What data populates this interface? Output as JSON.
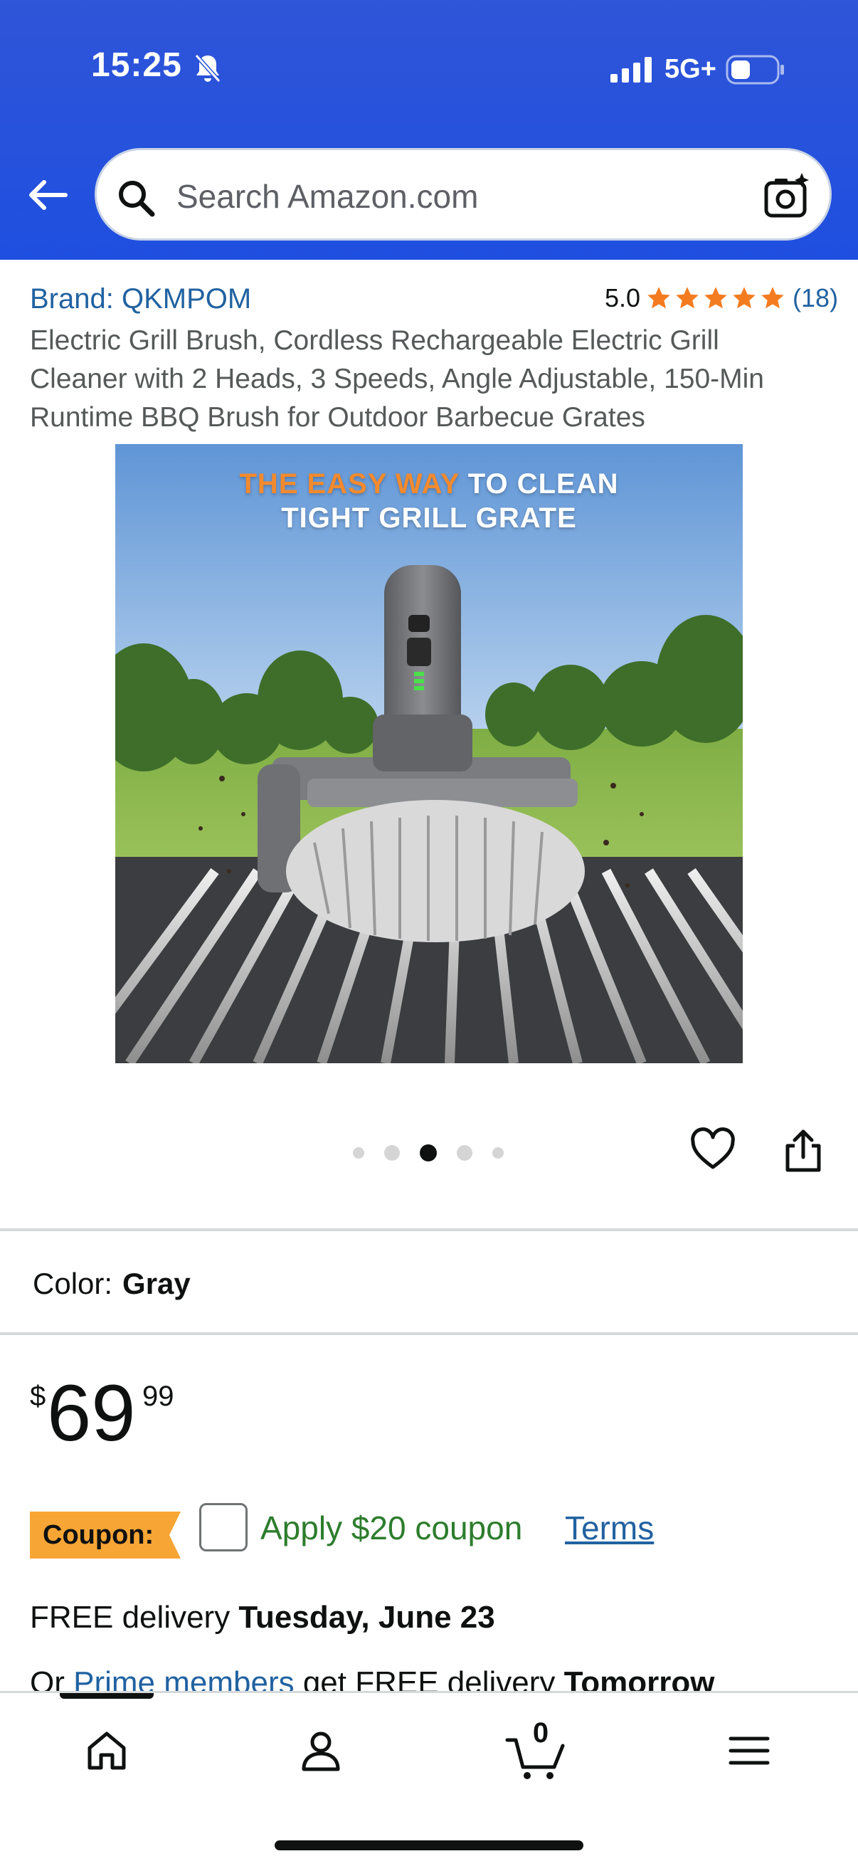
{
  "status_bar": {
    "time": "15:25",
    "network": "5G+",
    "icons": [
      "bell-off-icon",
      "signal-icon",
      "battery-icon"
    ]
  },
  "search": {
    "placeholder": "Search Amazon.com",
    "icons": [
      "back-arrow-icon",
      "search-icon",
      "camera-search-icon"
    ]
  },
  "product": {
    "brand": "Brand: QKMPOM",
    "rating_value": "5.0",
    "rating_stars": 5,
    "rating_count": "(18)",
    "title": "Electric Grill Brush, Cordless Rechargeable Electric Grill Cleaner with 2 Heads, 3 Speeds, Angle Adjustable, 150-Min Runtime BBQ Brush for Outdoor Barbecue Grates",
    "image_headline_accent": "THE EASY WAY",
    "image_headline_rest": " TO CLEAN",
    "image_headline_line2": "TIGHT GRILL GRATE",
    "carousel_dots": 5,
    "carousel_active_dot": 3
  },
  "variation": {
    "color_label": "Color:",
    "color_value": "Gray"
  },
  "pricing": {
    "currency_symbol": "$",
    "whole": "69",
    "fraction": "99"
  },
  "coupon": {
    "badge": "Coupon:",
    "apply_text": "Apply $20 coupon",
    "terms": "Terms",
    "checked": false
  },
  "delivery": {
    "prefix": "FREE delivery ",
    "date": "Tuesday, June 23",
    "prime_prefix": "Or ",
    "prime_link": "Prime members",
    "prime_middle": " get FREE delivery ",
    "prime_date": "Tomorrow"
  },
  "bottom_nav": {
    "items": [
      "home-icon",
      "account-icon",
      "cart-icon",
      "menu-icon"
    ],
    "cart_count": "0",
    "active_index": 0
  },
  "colors": {
    "header_blue": "#1f4fe0",
    "link_blue": "#2162a1",
    "star_orange": "#f47c20",
    "coupon_orange": "#f7a535",
    "coupon_green": "#2d7d2d"
  }
}
